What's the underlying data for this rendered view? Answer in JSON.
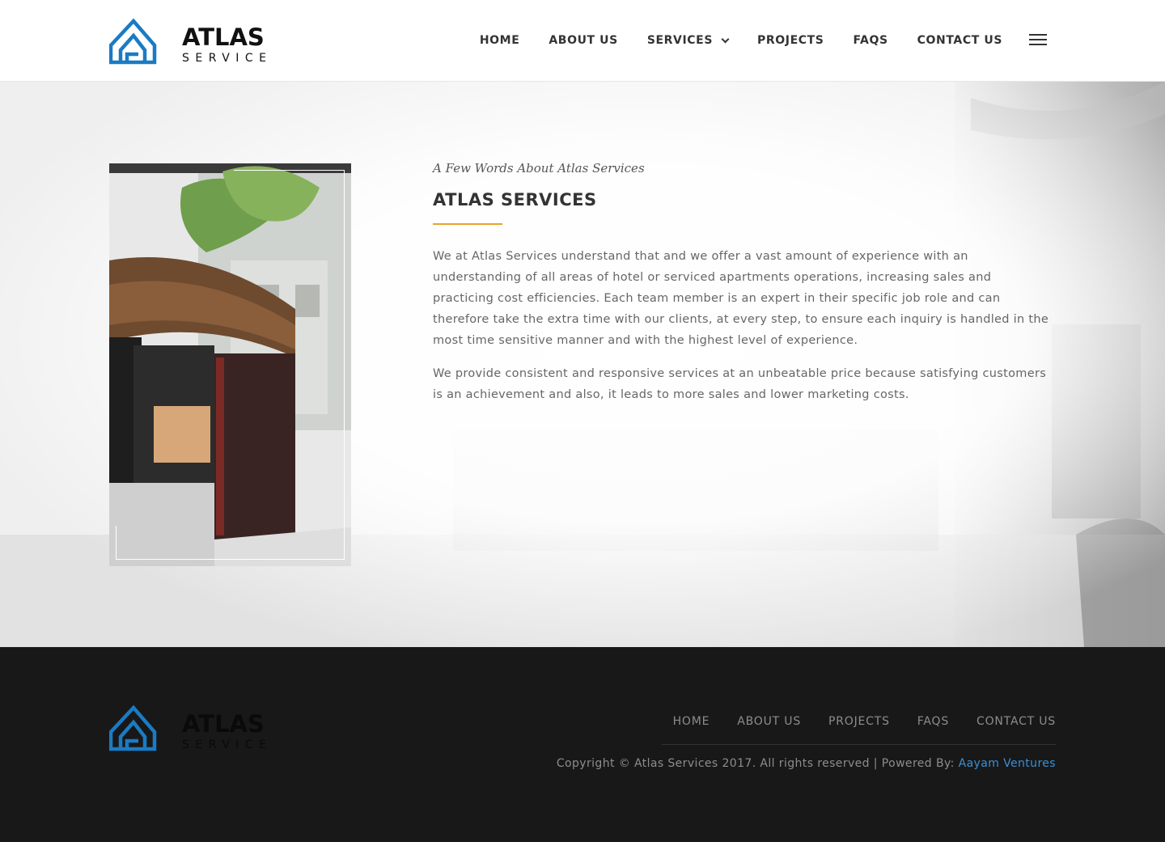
{
  "brand": {
    "logo_word": "ATLAS",
    "logo_sub": "SERVICE",
    "logo_blue": "#1a7bc4",
    "logo_black": "#111111"
  },
  "header": {
    "nav": [
      {
        "label": "HOME"
      },
      {
        "label": "ABOUT US"
      },
      {
        "label": "SERVICES",
        "has_dropdown": true
      },
      {
        "label": "PROJECTS"
      },
      {
        "label": "FAQS"
      },
      {
        "label": "CONTACT US"
      }
    ],
    "menu_icon": "hamburger-icon"
  },
  "about": {
    "subtitle": "A Few Words About Atlas Services",
    "title": "ATLAS SERVICES",
    "accent_color": "#e8a42c",
    "paragraphs": [
      "We at Atlas Services understand that and we offer a vast amount of experience with an understanding of all areas of hotel or serviced apartments operations, increasing sales and practicing cost efficiencies. Each team member is an expert in their specific job role and can therefore take the extra time with our clients, at every step, to ensure each inquiry is handled in the most time sensitive manner and with the highest level of experience.",
      "We provide consistent and responsive services at an unbeatable price because satisfying customers is an achievement and also, it leads to more sales and lower marketing costs."
    ]
  },
  "footer": {
    "nav": [
      {
        "label": "HOME"
      },
      {
        "label": "ABOUT US"
      },
      {
        "label": "PROJECTS"
      },
      {
        "label": "FAQS"
      },
      {
        "label": "CONTACT US"
      }
    ],
    "copyright_text": "Copyright © Atlas Services 2017. All rights reserved | Powered By: ",
    "powered_by_link": "Aayam Ventures",
    "link_color": "#3a8fd6"
  }
}
